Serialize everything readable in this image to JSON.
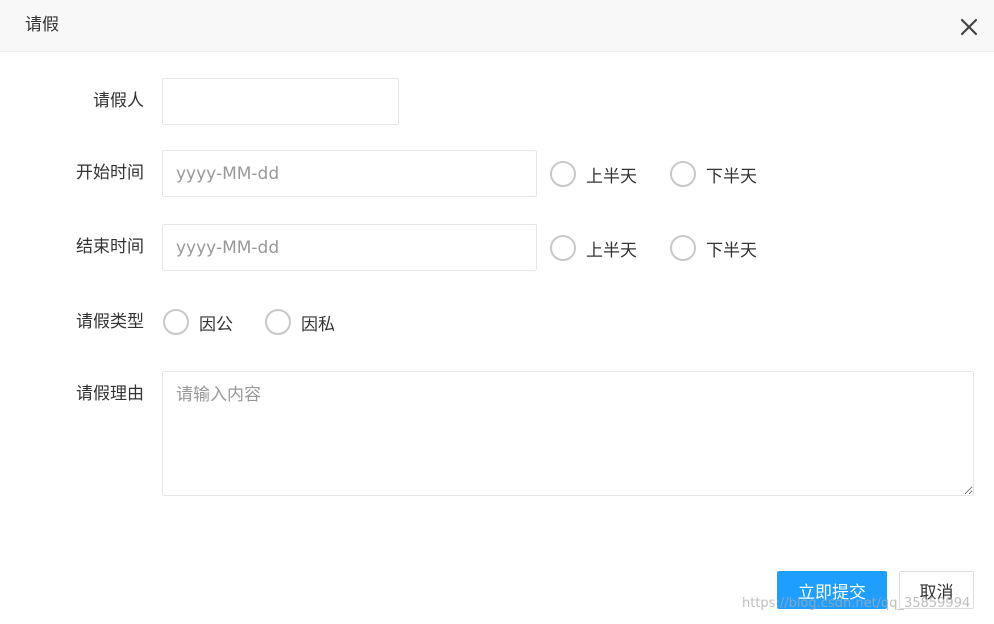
{
  "dialog": {
    "title": "请假",
    "close_icon": "close-icon"
  },
  "form": {
    "applicant": {
      "label": "请假人",
      "value": ""
    },
    "start_time": {
      "label": "开始时间",
      "placeholder": "yyyy-MM-dd",
      "options": [
        "上半天",
        "下半天"
      ]
    },
    "end_time": {
      "label": "结束时间",
      "placeholder": "yyyy-MM-dd",
      "options": [
        "上半天",
        "下半天"
      ]
    },
    "leave_type": {
      "label": "请假类型",
      "options": [
        "因公",
        "因私"
      ]
    },
    "reason": {
      "label": "请假理由",
      "placeholder": "请输入内容"
    }
  },
  "actions": {
    "submit_label": "立即提交",
    "cancel_label": "取消"
  },
  "watermark": "https://blog.csdn.net/qq_35859994",
  "colors": {
    "primary": "#1e9fff",
    "header_bg": "#f8f8f8",
    "border": "#e6e6e6"
  }
}
